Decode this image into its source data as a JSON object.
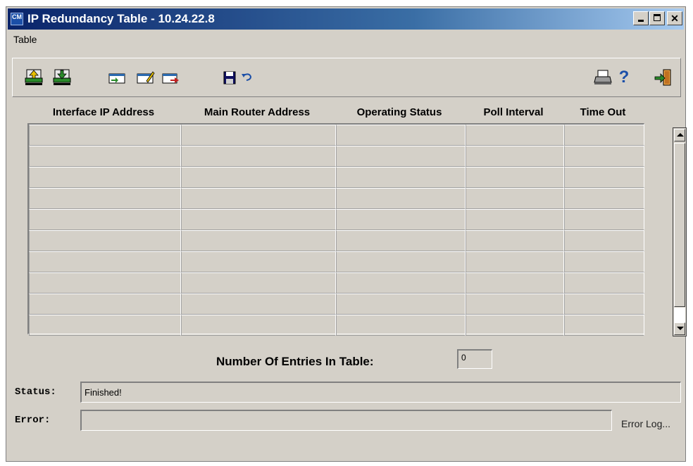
{
  "window": {
    "title": "IP Redundancy Table - 10.24.22.8",
    "app_icon_text": "CM",
    "app_icon": "cm-app-icon"
  },
  "menu": {
    "items": [
      {
        "label": "Table"
      }
    ]
  },
  "toolbar": {
    "icons": [
      "upload-table-icon",
      "download-table-icon",
      "add-row-icon",
      "edit-row-icon",
      "delete-row-icon",
      "save-icon",
      "undo-icon",
      "print-icon",
      "help-icon",
      "exit-icon"
    ],
    "help_glyph": "?"
  },
  "table": {
    "columns": [
      "Interface IP Address",
      "Main Router Address",
      "Operating Status",
      "Poll Interval",
      "Time Out"
    ],
    "rows": [
      [
        "",
        "",
        "",
        "",
        ""
      ],
      [
        "",
        "",
        "",
        "",
        ""
      ],
      [
        "",
        "",
        "",
        "",
        ""
      ],
      [
        "",
        "",
        "",
        "",
        ""
      ],
      [
        "",
        "",
        "",
        "",
        ""
      ],
      [
        "",
        "",
        "",
        "",
        ""
      ],
      [
        "",
        "",
        "",
        "",
        ""
      ],
      [
        "",
        "",
        "",
        "",
        ""
      ],
      [
        "",
        "",
        "",
        "",
        ""
      ],
      [
        "",
        "",
        "",
        "",
        ""
      ]
    ]
  },
  "entries": {
    "label": "Number Of Entries In Table:",
    "value": "0"
  },
  "status": {
    "label": "Status:",
    "value": "Finished!"
  },
  "error": {
    "label": "Error:",
    "value": "",
    "log_label": "Error Log..."
  },
  "colors": {
    "titlebar_start": "#0a246a",
    "titlebar_end": "#a6caf0",
    "face": "#d4d0c8"
  }
}
